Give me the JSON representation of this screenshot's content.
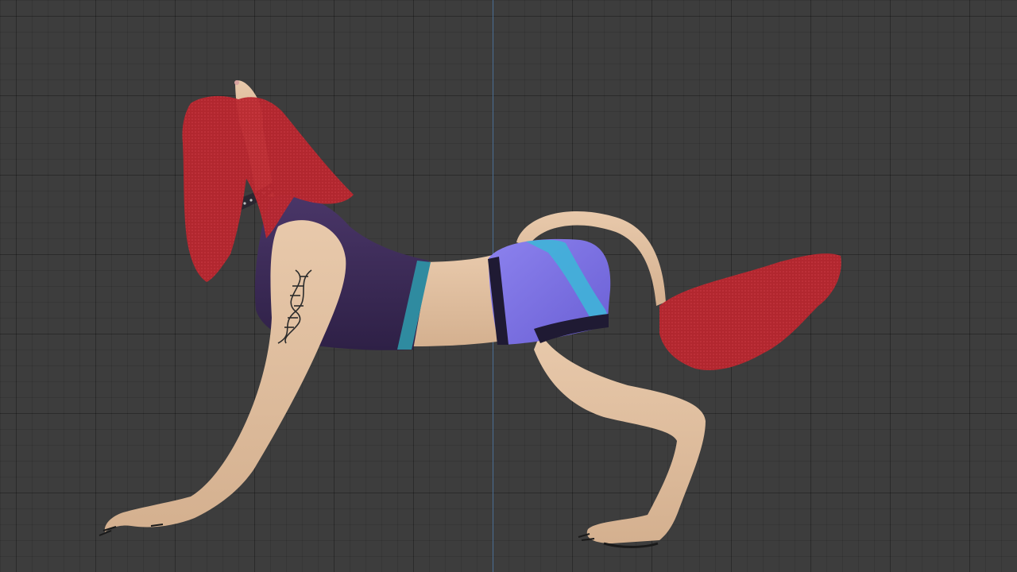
{
  "viewport": {
    "kind": "3d-viewport-orthographic-side",
    "grid": true,
    "axis_line_color": "#4a6e94",
    "background_color": "#3d3d3d"
  },
  "model": {
    "description_icon": "character-model",
    "colors": {
      "skin": "#e3c2a3",
      "hair": "#b8262e",
      "top": "#3f2c5a",
      "top_trim": "#2f8ba0",
      "shorts": "#7a6fe0",
      "shorts_stripe": "#3fb4d8",
      "shorts_band": "#1f1a33",
      "collar": "#2a2630"
    }
  }
}
